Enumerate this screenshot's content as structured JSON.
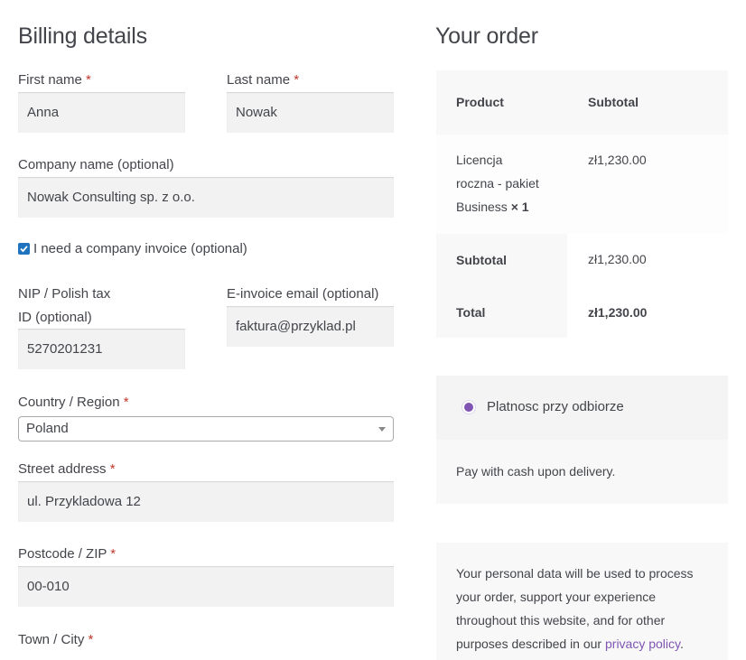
{
  "billing": {
    "title": "Billing details",
    "first_name": {
      "label": "First name",
      "required_mark": "*",
      "value": "Anna"
    },
    "last_name": {
      "label": "Last name",
      "required_mark": "*",
      "value": "Nowak"
    },
    "company": {
      "label": "Company name (optional)",
      "value": "Nowak Consulting sp. z o.o."
    },
    "invoice_checkbox": {
      "label": "I need a company invoice (optional)",
      "checked": true
    },
    "nip": {
      "label_line1": "NIP / Polish tax",
      "label_line2": "ID (optional)",
      "value": "5270201231"
    },
    "einvoice": {
      "label": "E-invoice email (optional)",
      "value": "faktura@przyklad.pl"
    },
    "country": {
      "label": "Country / Region",
      "required_mark": "*",
      "value": "Poland"
    },
    "street": {
      "label": "Street address",
      "required_mark": "*",
      "value": "ul. Przykladowa 12"
    },
    "postcode": {
      "label": "Postcode / ZIP",
      "required_mark": "*",
      "value": "00-010"
    },
    "town": {
      "label": "Town / City",
      "required_mark": "*"
    }
  },
  "order": {
    "title": "Your order",
    "table": {
      "header_product": "Product",
      "header_subtotal": "Subtotal",
      "item": {
        "name_line1": "Licencja",
        "name_line2": "roczna - pakiet",
        "name_line3": "Business",
        "qty": "× 1",
        "price": "zł1,230.00"
      },
      "subtotal_label": "Subtotal",
      "subtotal_value": "zł1,230.00",
      "total_label": "Total",
      "total_value": "zł1,230.00"
    },
    "payment": {
      "method_label": "Platnosc przy odbiorze",
      "description": "Pay with cash upon delivery."
    },
    "privacy": {
      "line1": "Your personal data will be used to process",
      "line2": "your order, support your experience",
      "line3": "throughout this website, and for other",
      "line4_prefix": "purposes described in our",
      "link": "privacy policy",
      "line4_suffix": "."
    }
  },
  "colors": {
    "accent": "#7f54b3",
    "input_bg": "#f2f2f2",
    "panel_bg": "#f8f8f8",
    "required": "#c0392b",
    "checkbox": "#1e73be"
  }
}
